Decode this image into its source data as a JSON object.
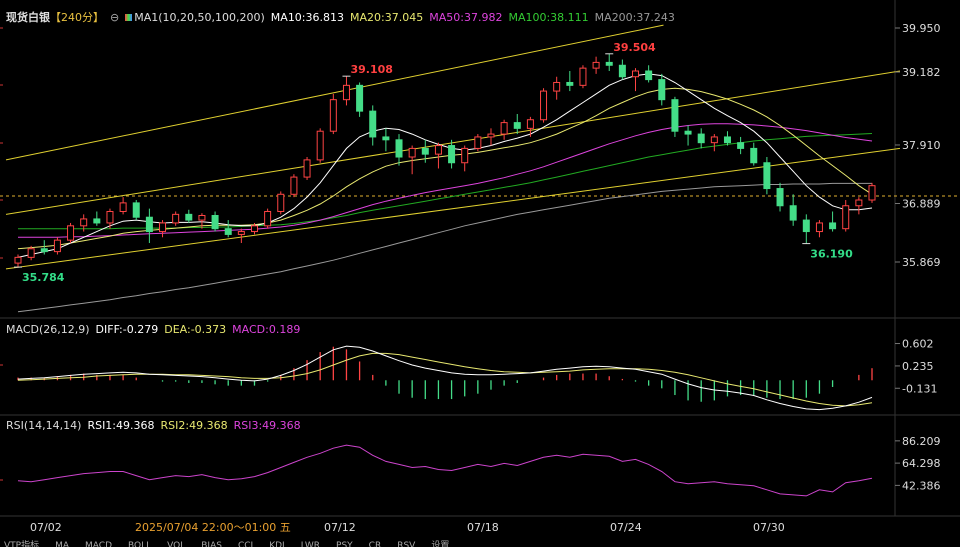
{
  "title": "现货白银",
  "period": "【240分】",
  "header": {
    "ma_params": "MA1(10,20,50,100,200)",
    "ma10": "MA10:36.813",
    "ma20": "MA20:37.045",
    "ma50": "MA50:37.982",
    "ma100": "MA100:38.111",
    "ma200": "MA200:37.243"
  },
  "macd_header": {
    "params": "MACD(26,12,9)",
    "diff": "DIFF:-0.279",
    "dea": "DEA:-0.373",
    "macd": "MACD:0.189"
  },
  "rsi_header": {
    "params": "RSI(14,14,14)",
    "rsi1": "RSI1:49.368",
    "rsi2": "RSI2:49.368",
    "rsi3": "RSI3:49.368"
  },
  "price_axis": [
    "39.950",
    "39.182",
    "37.910",
    "36.889",
    "35.869"
  ],
  "macd_axis": [
    "0.602",
    "0.235",
    "-0.131"
  ],
  "rsi_axis": [
    "86.209",
    "64.298",
    "42.386"
  ],
  "x_axis": [
    "07/02",
    "07/12",
    "07/18",
    "07/24",
    "07/30"
  ],
  "crosshair_label": "2025/07/04 22:00～01:00 五",
  "annotations": {
    "high1": "39.108",
    "high2": "39.504",
    "low1": "35.784",
    "low2": "36.190"
  },
  "toolbar": [
    "VTP指标",
    "MA",
    "MACD",
    "BOLL",
    "VOL",
    "BIAS",
    "CCI",
    "KDJ",
    "LWR",
    "PSY",
    "CR",
    "RSV",
    "设置"
  ],
  "colors": {
    "up": "#ff4444",
    "down": "#44dd88",
    "ma10": "#ffffff",
    "ma20": "#e8e870",
    "ma50": "#dd44dd",
    "ma100": "#22aa22",
    "ma200": "#999999",
    "channel": "#e0d030",
    "label_red": "#ff4040",
    "label_green": "#33dd88"
  },
  "chart_data": {
    "type": "candlestick",
    "price": [
      [
        35.85,
        36.0,
        35.78,
        35.95
      ],
      [
        35.95,
        36.15,
        35.9,
        36.1
      ],
      [
        36.1,
        36.25,
        36.0,
        36.05
      ],
      [
        36.05,
        36.3,
        36.0,
        36.25
      ],
      [
        36.25,
        36.55,
        36.2,
        36.5
      ],
      [
        36.5,
        36.7,
        36.4,
        36.62
      ],
      [
        36.62,
        36.75,
        36.5,
        36.55
      ],
      [
        36.55,
        36.8,
        36.45,
        36.75
      ],
      [
        36.75,
        37.0,
        36.7,
        36.9
      ],
      [
        36.9,
        36.95,
        36.6,
        36.65
      ],
      [
        36.65,
        36.8,
        36.2,
        36.4
      ],
      [
        36.4,
        36.6,
        36.3,
        36.55
      ],
      [
        36.55,
        36.75,
        36.5,
        36.7
      ],
      [
        36.7,
        36.78,
        36.55,
        36.6
      ],
      [
        36.6,
        36.72,
        36.45,
        36.68
      ],
      [
        36.68,
        36.75,
        36.4,
        36.45
      ],
      [
        36.45,
        36.6,
        36.3,
        36.35
      ],
      [
        36.35,
        36.45,
        36.2,
        36.4
      ],
      [
        36.4,
        36.55,
        36.35,
        36.5
      ],
      [
        36.5,
        36.8,
        36.45,
        36.75
      ],
      [
        36.75,
        37.1,
        36.7,
        37.05
      ],
      [
        37.05,
        37.4,
        37.0,
        37.35
      ],
      [
        37.35,
        37.7,
        37.3,
        37.65
      ],
      [
        37.65,
        38.2,
        37.6,
        38.15
      ],
      [
        38.15,
        38.8,
        38.1,
        38.7
      ],
      [
        38.7,
        39.11,
        38.6,
        38.95
      ],
      [
        38.95,
        39.0,
        38.4,
        38.5
      ],
      [
        38.5,
        38.6,
        37.9,
        38.05
      ],
      [
        38.05,
        38.2,
        37.8,
        38.0
      ],
      [
        38.0,
        38.1,
        37.55,
        37.7
      ],
      [
        37.7,
        37.9,
        37.4,
        37.85
      ],
      [
        37.85,
        38.0,
        37.6,
        37.75
      ],
      [
        37.75,
        37.95,
        37.5,
        37.9
      ],
      [
        37.9,
        38.0,
        37.5,
        37.6
      ],
      [
        37.6,
        37.9,
        37.45,
        37.85
      ],
      [
        37.85,
        38.1,
        37.8,
        38.05
      ],
      [
        38.05,
        38.2,
        37.9,
        38.1
      ],
      [
        38.1,
        38.35,
        38.0,
        38.3
      ],
      [
        38.3,
        38.45,
        38.1,
        38.2
      ],
      [
        38.2,
        38.4,
        38.05,
        38.35
      ],
      [
        38.35,
        38.9,
        38.3,
        38.85
      ],
      [
        38.85,
        39.1,
        38.7,
        39.0
      ],
      [
        39.0,
        39.2,
        38.85,
        38.95
      ],
      [
        38.95,
        39.3,
        38.9,
        39.25
      ],
      [
        39.25,
        39.45,
        39.15,
        39.35
      ],
      [
        39.35,
        39.5,
        39.2,
        39.3
      ],
      [
        39.3,
        39.4,
        39.05,
        39.1
      ],
      [
        39.1,
        39.25,
        38.85,
        39.2
      ],
      [
        39.2,
        39.3,
        39.0,
        39.05
      ],
      [
        39.05,
        39.15,
        38.6,
        38.7
      ],
      [
        38.7,
        38.75,
        38.05,
        38.15
      ],
      [
        38.15,
        38.25,
        37.9,
        38.1
      ],
      [
        38.1,
        38.2,
        37.85,
        37.95
      ],
      [
        37.95,
        38.1,
        37.8,
        38.05
      ],
      [
        38.05,
        38.15,
        37.9,
        37.95
      ],
      [
        37.95,
        38.05,
        37.75,
        37.85
      ],
      [
        37.85,
        37.95,
        37.55,
        37.6
      ],
      [
        37.6,
        37.7,
        37.05,
        37.15
      ],
      [
        37.15,
        37.25,
        36.75,
        36.85
      ],
      [
        36.85,
        37.05,
        36.5,
        36.6
      ],
      [
        36.6,
        36.7,
        36.19,
        36.4
      ],
      [
        36.4,
        36.6,
        36.3,
        36.55
      ],
      [
        36.55,
        36.75,
        36.4,
        36.45
      ],
      [
        36.45,
        36.95,
        36.4,
        36.85
      ],
      [
        36.85,
        37.0,
        36.7,
        36.95
      ],
      [
        36.95,
        37.25,
        36.9,
        37.2
      ]
    ],
    "ma": {
      "ma10": [
        35.95,
        36.0,
        36.05,
        36.1,
        36.2,
        36.3,
        36.4,
        36.5,
        36.58,
        36.6,
        36.57,
        36.55,
        36.56,
        36.56,
        36.57,
        36.55,
        36.52,
        36.5,
        36.5,
        36.55,
        36.65,
        36.8,
        37.0,
        37.25,
        37.55,
        37.85,
        38.05,
        38.15,
        38.2,
        38.18,
        38.1,
        38.0,
        37.92,
        37.85,
        37.82,
        37.85,
        37.9,
        37.97,
        38.03,
        38.1,
        38.22,
        38.35,
        38.5,
        38.65,
        38.8,
        38.95,
        39.05,
        39.12,
        39.15,
        39.12,
        39.0,
        38.85,
        38.7,
        38.55,
        38.42,
        38.3,
        38.15,
        37.95,
        37.7,
        37.45,
        37.2,
        37.0,
        36.85,
        36.78,
        36.78,
        36.81
      ],
      "ma20": [
        36.1,
        36.12,
        36.14,
        36.16,
        36.2,
        36.24,
        36.28,
        36.32,
        36.37,
        36.4,
        36.42,
        36.44,
        36.46,
        36.48,
        36.5,
        36.51,
        36.51,
        36.51,
        36.52,
        36.55,
        36.6,
        36.68,
        36.77,
        36.88,
        37.02,
        37.18,
        37.32,
        37.44,
        37.54,
        37.6,
        37.64,
        37.67,
        37.7,
        37.73,
        37.75,
        37.78,
        37.82,
        37.86,
        37.9,
        37.95,
        38.02,
        38.1,
        38.2,
        38.3,
        38.42,
        38.55,
        38.65,
        38.75,
        38.83,
        38.88,
        38.9,
        38.88,
        38.84,
        38.78,
        38.71,
        38.62,
        38.52,
        38.4,
        38.25,
        38.08,
        37.9,
        37.72,
        37.55,
        37.38,
        37.2,
        37.05
      ],
      "ma50": [
        36.3,
        36.3,
        36.3,
        36.3,
        36.31,
        36.31,
        36.32,
        36.33,
        36.34,
        36.35,
        36.36,
        36.37,
        36.38,
        36.39,
        36.4,
        36.41,
        36.42,
        36.43,
        36.44,
        36.46,
        36.48,
        36.51,
        36.55,
        36.6,
        36.66,
        36.73,
        36.8,
        36.87,
        36.93,
        36.98,
        37.03,
        37.08,
        37.12,
        37.16,
        37.2,
        37.24,
        37.29,
        37.34,
        37.4,
        37.46,
        37.53,
        37.61,
        37.69,
        37.77,
        37.85,
        37.93,
        38.0,
        38.07,
        38.13,
        38.18,
        38.22,
        38.25,
        38.27,
        38.28,
        38.28,
        38.27,
        38.26,
        38.24,
        38.22,
        38.19,
        38.16,
        38.12,
        38.08,
        38.04,
        38.01,
        37.98
      ],
      "ma100": [
        36.45,
        36.45,
        36.45,
        36.45,
        36.45,
        36.45,
        36.45,
        36.45,
        36.46,
        36.46,
        36.46,
        36.46,
        36.46,
        36.47,
        36.47,
        36.48,
        36.48,
        36.49,
        36.5,
        36.51,
        36.52,
        36.54,
        36.57,
        36.6,
        36.64,
        36.68,
        36.73,
        36.77,
        36.81,
        36.85,
        36.89,
        36.93,
        36.97,
        37.01,
        37.05,
        37.09,
        37.13,
        37.17,
        37.21,
        37.25,
        37.3,
        37.35,
        37.4,
        37.45,
        37.5,
        37.55,
        37.6,
        37.65,
        37.7,
        37.74,
        37.78,
        37.82,
        37.86,
        37.89,
        37.92,
        37.95,
        37.98,
        38.0,
        38.02,
        38.04,
        38.06,
        38.07,
        38.08,
        38.09,
        38.1,
        38.11
      ],
      "ma200": [
        35.0,
        35.03,
        35.06,
        35.09,
        35.12,
        35.15,
        35.18,
        35.21,
        35.25,
        35.28,
        35.32,
        35.35,
        35.39,
        35.42,
        35.46,
        35.5,
        35.54,
        35.58,
        35.62,
        35.66,
        35.7,
        35.75,
        35.8,
        35.85,
        35.9,
        35.96,
        36.02,
        36.08,
        36.14,
        36.2,
        36.26,
        36.32,
        36.38,
        36.44,
        36.5,
        36.55,
        36.6,
        36.65,
        36.7,
        36.74,
        36.78,
        36.82,
        36.86,
        36.9,
        36.94,
        36.98,
        37.01,
        37.04,
        37.07,
        37.1,
        37.12,
        37.14,
        37.16,
        37.18,
        37.19,
        37.2,
        37.21,
        37.22,
        37.22,
        37.23,
        37.23,
        37.23,
        37.24,
        37.24,
        37.24,
        37.24
      ]
    },
    "channel": [
      {
        "from": [
          0,
          37.65
        ],
        "to": [
          47,
          40.0
        ]
      },
      {
        "from": [
          0,
          36.7
        ],
        "to": [
          65,
          39.2
        ]
      },
      {
        "from": [
          0,
          35.75
        ],
        "to": [
          65,
          37.85
        ]
      }
    ],
    "ref_price": 37.02,
    "ylim": [
      35.4,
      40.1
    ],
    "macd": {
      "diff": [
        0.02,
        0.03,
        0.04,
        0.06,
        0.08,
        0.1,
        0.11,
        0.12,
        0.13,
        0.12,
        0.1,
        0.09,
        0.08,
        0.07,
        0.06,
        0.04,
        0.02,
        0.0,
        -0.01,
        0.02,
        0.08,
        0.16,
        0.26,
        0.38,
        0.5,
        0.56,
        0.54,
        0.48,
        0.4,
        0.32,
        0.25,
        0.2,
        0.16,
        0.12,
        0.1,
        0.09,
        0.09,
        0.1,
        0.11,
        0.12,
        0.15,
        0.18,
        0.2,
        0.22,
        0.23,
        0.22,
        0.2,
        0.18,
        0.14,
        0.1,
        0.02,
        -0.06,
        -0.12,
        -0.16,
        -0.18,
        -0.21,
        -0.25,
        -0.32,
        -0.38,
        -0.43,
        -0.47,
        -0.48,
        -0.46,
        -0.42,
        -0.36,
        -0.28
      ],
      "dea": [
        0.0,
        0.01,
        0.02,
        0.03,
        0.04,
        0.05,
        0.07,
        0.08,
        0.09,
        0.1,
        0.1,
        0.1,
        0.09,
        0.09,
        0.08,
        0.07,
        0.06,
        0.04,
        0.03,
        0.03,
        0.04,
        0.07,
        0.11,
        0.17,
        0.25,
        0.33,
        0.4,
        0.44,
        0.44,
        0.42,
        0.38,
        0.34,
        0.3,
        0.26,
        0.22,
        0.19,
        0.16,
        0.14,
        0.13,
        0.12,
        0.13,
        0.14,
        0.15,
        0.17,
        0.18,
        0.19,
        0.19,
        0.19,
        0.18,
        0.16,
        0.13,
        0.09,
        0.04,
        -0.01,
        -0.06,
        -0.1,
        -0.14,
        -0.19,
        -0.24,
        -0.29,
        -0.34,
        -0.38,
        -0.41,
        -0.42,
        -0.4,
        -0.37
      ],
      "ylim": [
        -0.52,
        0.66
      ]
    },
    "rsi": {
      "values": [
        47,
        46,
        48,
        50,
        52,
        54,
        55,
        56,
        56,
        52,
        48,
        50,
        52,
        51,
        53,
        50,
        48,
        49,
        51,
        55,
        60,
        65,
        70,
        74,
        79,
        82,
        80,
        72,
        66,
        63,
        60,
        61,
        58,
        57,
        60,
        63,
        61,
        64,
        62,
        66,
        70,
        72,
        70,
        73,
        72,
        71,
        66,
        68,
        63,
        56,
        46,
        44,
        45,
        46,
        44,
        43,
        42,
        38,
        34,
        33,
        32,
        38,
        36,
        45,
        47,
        49.4
      ],
      "ylim": [
        28,
        90
      ]
    }
  }
}
